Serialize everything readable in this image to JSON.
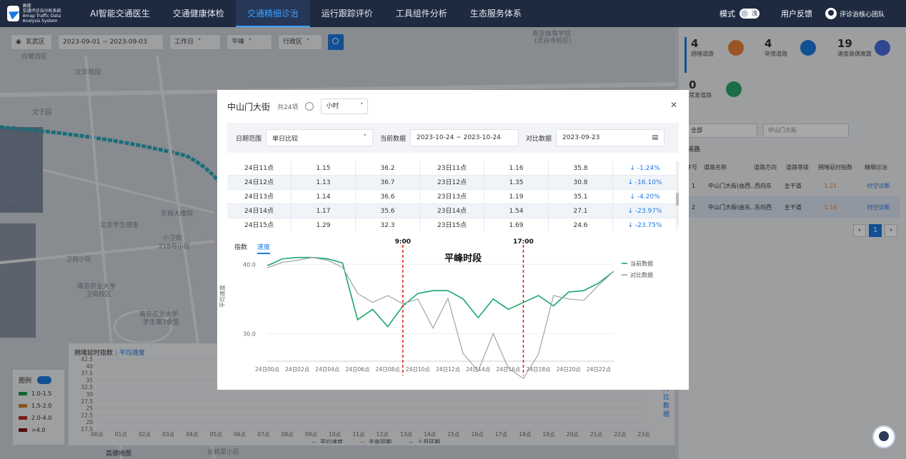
{
  "app": {
    "logo_line1": "高德",
    "logo_line2": "交通评诊治分析系统",
    "logo_line3": "Amap Traffic Data Analysis System"
  },
  "nav": [
    "AI智能交通医生",
    "交通健康体检",
    "交通精细诊治",
    "运行跟踪评价",
    "工具组件分析",
    "生态服务体系"
  ],
  "top_right": {
    "mode_label": "模式",
    "mode_toggle": "浅",
    "feedback": "用户反馈",
    "team": "评诊治核心团队"
  },
  "filters": {
    "district": "玄武区",
    "date_range": "2023-09-01 ~ 2023-09-03",
    "day_type": "工作日",
    "peak": "平峰",
    "area_type": "行政区"
  },
  "map_labels": [
    "南京体育学院",
    "(灵谷寺校区)",
    "白鹭坊区",
    "文华苑园",
    "文子园",
    "长鹤小区",
    "北京学生宿舍",
    "小卫街",
    "218号小区",
    "卫岗小区",
    "南京农业大学",
    "卫岗校区",
    "南京农业大学",
    "学生第3食堂",
    "东岗大楼院",
    "长鹤菜小区",
    "高德地图"
  ],
  "right_panel": {
    "stats": [
      {
        "num": "4",
        "label": "拥堵道路",
        "color": "#e8823a"
      },
      {
        "num": "4",
        "label": "突增道路",
        "color": "#1a7ae0"
      },
      {
        "num": "19",
        "label": "速度高偶离散",
        "color": "#4a6be0"
      },
      {
        "num": "0",
        "label": "常发道路",
        "color": "#2aa86a"
      }
    ],
    "filter_all": "全部",
    "search_placeholder": "中山门大街",
    "section": "道路",
    "table_headers": [
      "序号",
      "道路名称",
      "道路方向",
      "道路等级",
      "拥堵延时指数",
      "精细诊治"
    ],
    "rows": [
      {
        "idx": "1",
        "name": "中山门大街(由西...",
        "dir": "西向东",
        "level": "主干道",
        "value": "1.21",
        "action": "时空诊断"
      },
      {
        "idx": "2",
        "name": "中山门大街(由东...",
        "dir": "东向西",
        "level": "主干道",
        "value": "1.16",
        "action": "时空诊断"
      }
    ],
    "page": "1"
  },
  "legend_panel": {
    "title": "图例",
    "items": [
      {
        "label": "1.0-1.5",
        "color": "#1e9a4e"
      },
      {
        "label": "1.5-2.0",
        "color": "#c9822b"
      },
      {
        "label": "2.0-4.0",
        "color": "#b22f2a"
      },
      {
        "label": ">4.0",
        "color": "#7a1414"
      }
    ]
  },
  "bottom_chart": {
    "tab1": "拥堵延时指数",
    "tab2": "平均速度",
    "side_label": "对比数据",
    "y_ticks": [
      "42.5",
      "40",
      "37.5",
      "35",
      "32.5",
      "30",
      "27.5",
      "25",
      "22.5",
      "20",
      "17.5"
    ],
    "x_ticks": [
      "00点",
      "01点",
      "02点",
      "03点",
      "04点",
      "05点",
      "06点",
      "07点",
      "08点",
      "09点",
      "10点",
      "11点",
      "12点",
      "13点",
      "14点",
      "15点",
      "16点",
      "17点",
      "18点",
      "19点",
      "20点",
      "21点",
      "22点",
      "23点"
    ],
    "legend": [
      "平均速度",
      "去年同期",
      "上月环期"
    ]
  },
  "modal": {
    "title": "中山门大街",
    "count": "共24项",
    "unit_select": "小时",
    "date_range_label": "日期范围",
    "date_range_value": "单日比较",
    "current_label": "当前数据",
    "current_value": "2023-10-24 ~ 2023-10-24",
    "compare_label": "对比数据",
    "compare_value": "2023-09-23",
    "table_rows": [
      [
        "24日11点",
        "1.15",
        "36.2",
        "23日11点",
        "1.16",
        "35.8",
        "↓ -1.24%"
      ],
      [
        "24日12点",
        "1.13",
        "36.7",
        "23日12点",
        "1.35",
        "30.8",
        "↓ -16.10%"
      ],
      [
        "24日13点",
        "1.14",
        "36.6",
        "23日13点",
        "1.19",
        "35.1",
        "↓ -4.20%"
      ],
      [
        "24日14点",
        "1.17",
        "35.6",
        "23日14点",
        "1.54",
        "27.1",
        "↓ -23.97%"
      ],
      [
        "24日15点",
        "1.29",
        "32.3",
        "23日15点",
        "1.69",
        "24.6",
        "↓ -23.75%"
      ]
    ],
    "tab_index": "指数",
    "tab_speed": "速度",
    "ylabel": "平均速度",
    "peak_label": "平峰时段",
    "marker1": "9:00",
    "marker2": "17:00",
    "legend_current": "当前数据",
    "legend_compare": "对比数据"
  },
  "chart_data": {
    "type": "line",
    "ylabel": "平均速度",
    "ylim": [
      26,
      42
    ],
    "y_ticks": [
      "30.0",
      "40.0"
    ],
    "x": [
      "24日00点",
      "24日01点",
      "24日02点",
      "24日03点",
      "24日04点",
      "24日05点",
      "24日06点",
      "24日07点",
      "24日08点",
      "24日09点",
      "24日10点",
      "24日11点",
      "24日12点",
      "24日13点",
      "24日14点",
      "24日15点",
      "24日16点",
      "24日17点",
      "24日18点",
      "24日19点",
      "24日20点",
      "24日21点",
      "24日22点",
      "24日23点"
    ],
    "x_tick_labels": [
      "24日00点",
      "24日02点",
      "24日04点",
      "24日06点",
      "24日08点",
      "24日10点",
      "24日12点",
      "24日14点",
      "24日16点",
      "24日18点",
      "24日20点",
      "24日22点"
    ],
    "series": [
      {
        "name": "当前数据",
        "color": "#1aa66b",
        "values": [
          39.8,
          40.8,
          41.0,
          41.0,
          40.8,
          40.2,
          32.0,
          33.5,
          31.0,
          34.0,
          35.8,
          36.2,
          36.2,
          35.0,
          32.3,
          35.0,
          33.5,
          34.5,
          35.5,
          34.0,
          36.0,
          36.2,
          37.3,
          39.0
        ]
      },
      {
        "name": "对比数据",
        "color": "#9aa7a4",
        "values": [
          39.5,
          40.3,
          40.6,
          41.0,
          40.6,
          39.6,
          35.8,
          34.5,
          35.5,
          34.3,
          35.0,
          30.8,
          35.1,
          27.1,
          24.6,
          30.0,
          25.0,
          23.5,
          27.0,
          35.5,
          35.0,
          34.8,
          37.0,
          39.0
        ]
      }
    ],
    "annotations": [
      {
        "x": "24日09点",
        "label": "9:00"
      },
      {
        "x": "24日17点",
        "label": "17:00"
      },
      {
        "label": "平峰时段"
      }
    ]
  }
}
